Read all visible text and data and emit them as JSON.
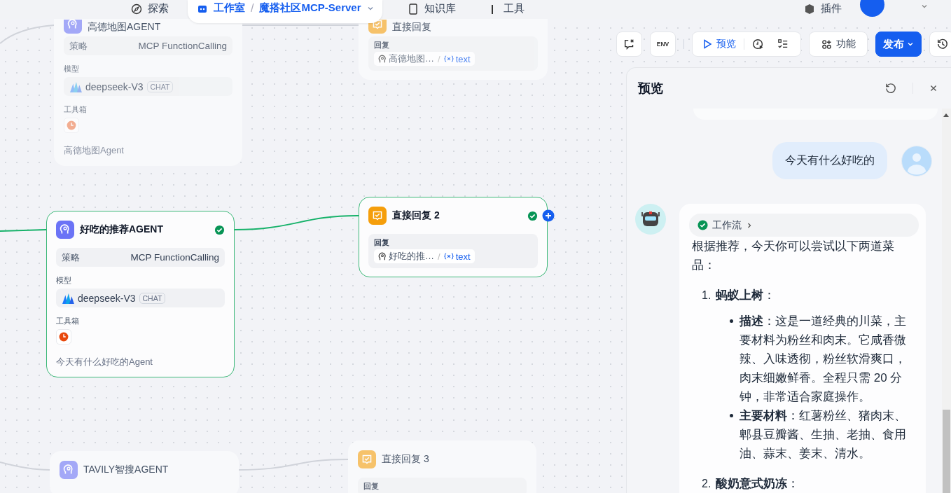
{
  "top_nav": {
    "explore": "探索",
    "workspace": "工作室",
    "separator": "/",
    "project": "魔搭社区MCP-Server",
    "knowledge": "知识库",
    "tools": "工具",
    "plugins": "插件"
  },
  "nodes": [
    {
      "kind": "agent",
      "title": "高德地图AGENT",
      "active": false,
      "strategy_label": "策略",
      "strategy": "MCP FunctionCalling",
      "model_label": "模型",
      "model": "deepseek-V3",
      "model_tag": "CHAT",
      "tools_label": "工具箱",
      "description": "高德地图Agent"
    },
    {
      "kind": "reply",
      "title": "直接回复",
      "active": false,
      "field_label": "回复",
      "source": "高德地图…",
      "separator": "/",
      "variable": "text"
    },
    {
      "kind": "agent",
      "title": "好吃的推荐AGENT",
      "active": true,
      "strategy_label": "策略",
      "strategy": "MCP FunctionCalling",
      "model_label": "模型",
      "model": "deepseek-V3",
      "model_tag": "CHAT",
      "tools_label": "工具箱",
      "description": "今天有什么好吃的Agent"
    },
    {
      "kind": "reply",
      "title": "直接回复 2",
      "active": true,
      "field_label": "回复",
      "source": "好吃的推…",
      "separator": "/",
      "variable": "text"
    },
    {
      "kind": "agent",
      "title": "TAVILY智搜AGENT",
      "active": false
    },
    {
      "kind": "reply",
      "title": "直接回复 3",
      "active": false,
      "field_label": "回复"
    }
  ],
  "toolbar": {
    "env": "ENV",
    "preview": "预览",
    "features": "功能",
    "publish": "发布"
  },
  "preview_panel": {
    "title": "预览",
    "user_message": "今天有什么好吃的",
    "workflow_chip": "工作流",
    "reply_intro": "根据推荐，今天你可以尝试以下两道菜品：",
    "dishes": [
      {
        "number": "1.",
        "title": "**蚂蚁上树**：",
        "points": [
          "**描述**：这是一道经典的川菜，主要材料为粉丝和肉末。它咸香微辣、入味透彻，粉丝软滑爽口，肉末细嫩鲜香。全程只需 20 分钟，非常适合家庭操作。",
          "**主要材料**：红薯粉丝、猪肉末、郫县豆瓣酱、生抽、老抽、食用油、蒜末、姜末、清水。"
        ]
      },
      {
        "number": "2.",
        "title": "**酸奶意式奶冻**："
      }
    ]
  }
}
